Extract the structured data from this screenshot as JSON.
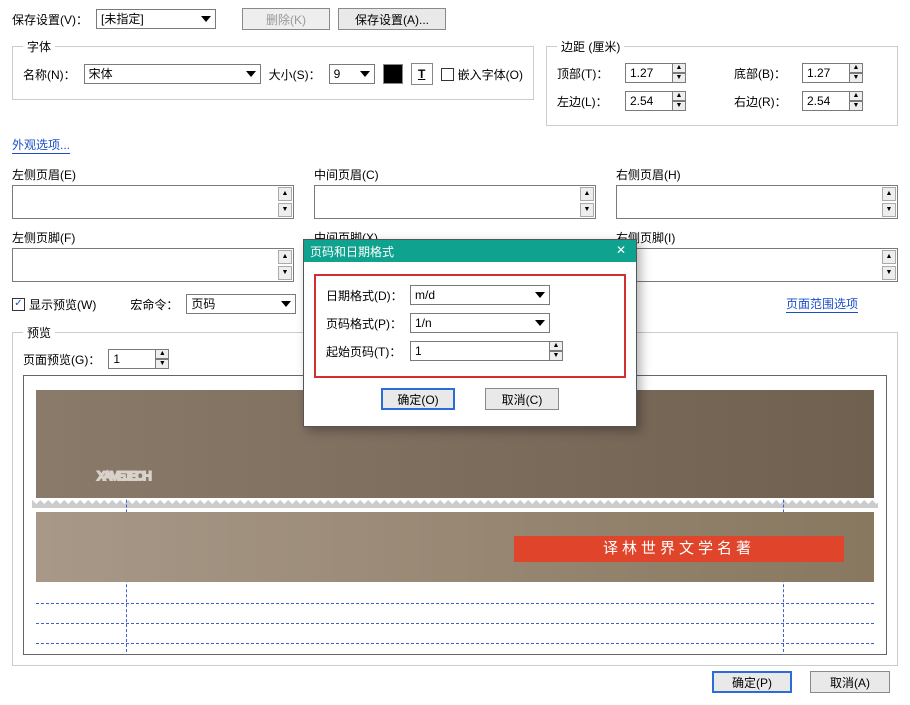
{
  "top": {
    "save_label": "保存设置(V)：",
    "save_value": "[未指定]",
    "delete_btn": "删除(K)",
    "save_btn": "保存设置(A)..."
  },
  "font_group": {
    "legend": "字体",
    "name_label": "名称(N)：",
    "name_value": "宋体",
    "size_label": "大小(S)：",
    "size_value": "9",
    "embed_label": "嵌入字体(O)"
  },
  "margin_group": {
    "legend": "边距 (厘米)",
    "top_label": "顶部(T)：",
    "top_value": "1.27",
    "bottom_label": "底部(B)：",
    "bottom_value": "1.27",
    "left_label": "左边(L)：",
    "left_value": "2.54",
    "right_label": "右边(R)：",
    "right_value": "2.54"
  },
  "appearance_link": "外观选项...",
  "headers": {
    "left_h": "左侧页眉(E)",
    "mid_h": "中间页眉(C)",
    "right_h": "右侧页眉(H)",
    "left_f": "左侧页脚(F)",
    "mid_f": "中间页脚(X)",
    "right_f": "右侧页脚(I)"
  },
  "controls": {
    "show_preview": "显示预览(W)",
    "macro_label": "宏命令：",
    "macro_value": "页码",
    "range_link": "页面范围选项"
  },
  "preview": {
    "legend": "预览",
    "page_label": "页面预览(G)：",
    "page_value": "1",
    "banner_text": "译林世界文学名著"
  },
  "modal": {
    "title": "页码和日期格式",
    "date_label": "日期格式(D)：",
    "date_value": "m/d",
    "page_label": "页码格式(P)：",
    "page_value": "1/n",
    "start_label": "起始页码(T)：",
    "start_value": "1",
    "ok": "确定(O)",
    "cancel": "取消(C)"
  },
  "footer": {
    "ok": "确定(P)",
    "cancel": "取消(A)"
  }
}
